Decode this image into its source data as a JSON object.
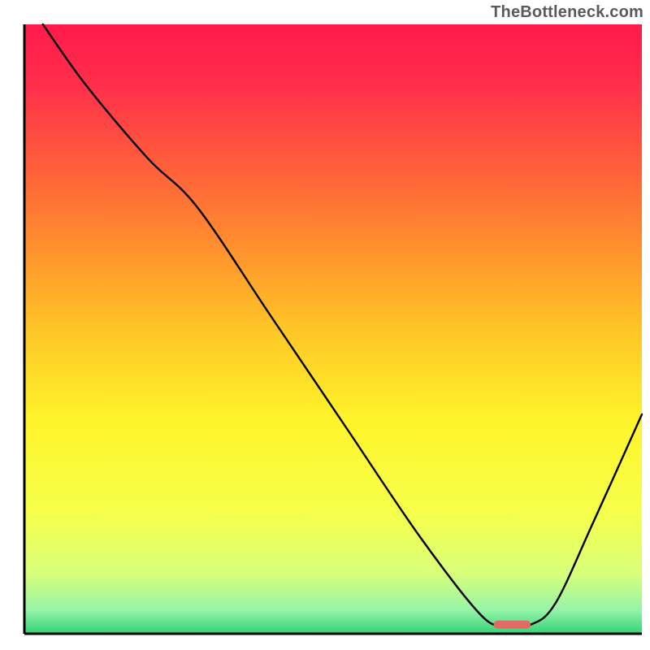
{
  "watermark": "TheBottleneck.com",
  "chart_data": {
    "type": "line",
    "title": "",
    "xlabel": "",
    "ylabel": "",
    "xlim": [
      0,
      100
    ],
    "ylim": [
      0,
      100
    ],
    "axes": {
      "left": true,
      "bottom": true,
      "top": false,
      "right": false,
      "grid": false
    },
    "background_gradient_stops": [
      {
        "offset": 0.0,
        "color": "#ff1a4b"
      },
      {
        "offset": 0.1,
        "color": "#ff2f4a"
      },
      {
        "offset": 0.22,
        "color": "#ff5a3c"
      },
      {
        "offset": 0.35,
        "color": "#ff8a2f"
      },
      {
        "offset": 0.5,
        "color": "#ffc527"
      },
      {
        "offset": 0.65,
        "color": "#fff42a"
      },
      {
        "offset": 0.8,
        "color": "#f6ff4a"
      },
      {
        "offset": 0.9,
        "color": "#d9ff79"
      },
      {
        "offset": 0.96,
        "color": "#97f5a8"
      },
      {
        "offset": 1.0,
        "color": "#35d27a"
      }
    ],
    "series": [
      {
        "name": "bottleneck-curve",
        "x": [
          3,
          10,
          20,
          28,
          40,
          52,
          64,
          74,
          78,
          82,
          86,
          92,
          100
        ],
        "y": [
          100,
          90,
          78,
          70,
          52,
          34,
          16,
          3,
          1.5,
          1.5,
          5,
          18,
          36
        ]
      }
    ],
    "marker": {
      "name": "optimal-range-bar",
      "x_start": 76,
      "x_end": 82,
      "y": 1.5,
      "color": "#e16a63",
      "thickness": 10
    }
  }
}
